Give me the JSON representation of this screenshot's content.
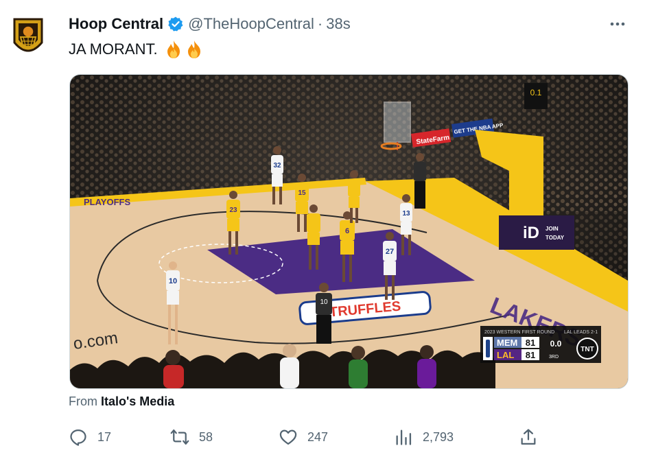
{
  "tweet": {
    "author_name": "Hoop Central",
    "handle": "@TheHoopCentral",
    "separator": "·",
    "time": "38s",
    "text": "JA MORANT.",
    "emoji_names": [
      "fire-emoji",
      "fire-emoji"
    ],
    "media_source_prefix": "From ",
    "media_source_name": "Italo's Media"
  },
  "media": {
    "sponsor_banner": "StateFarm",
    "nba_app_banner": "GET THE NBA APP",
    "join_sign_line1": "JOIN",
    "join_sign_line2": "TODAY",
    "id_sign": "iD",
    "courtside_text_left": "PLAYOFFS",
    "court_logo": "TRUFFLES",
    "baseline_text": "o.com",
    "shot_clock": "0.1",
    "jerseys": [
      "32",
      "15",
      "23",
      "6",
      "13",
      "27",
      "10",
      "10"
    ],
    "scoreboard": {
      "series_label": "2023 WESTERN FIRST ROUND",
      "series_status": "LAL LEADS 2-1",
      "team1": "MEM",
      "score1": "81",
      "team2": "LAL",
      "score2": "81",
      "clock": "0.0",
      "period": "3RD",
      "network": "TNT"
    }
  },
  "actions": {
    "replies": "17",
    "retweets": "58",
    "likes": "247",
    "views": "2,793"
  },
  "colors": {
    "verified_blue": "#1d9bf0",
    "text_secondary": "#536471",
    "lakers_gold": "#f5c518",
    "lakers_purple": "#4b2c84"
  }
}
